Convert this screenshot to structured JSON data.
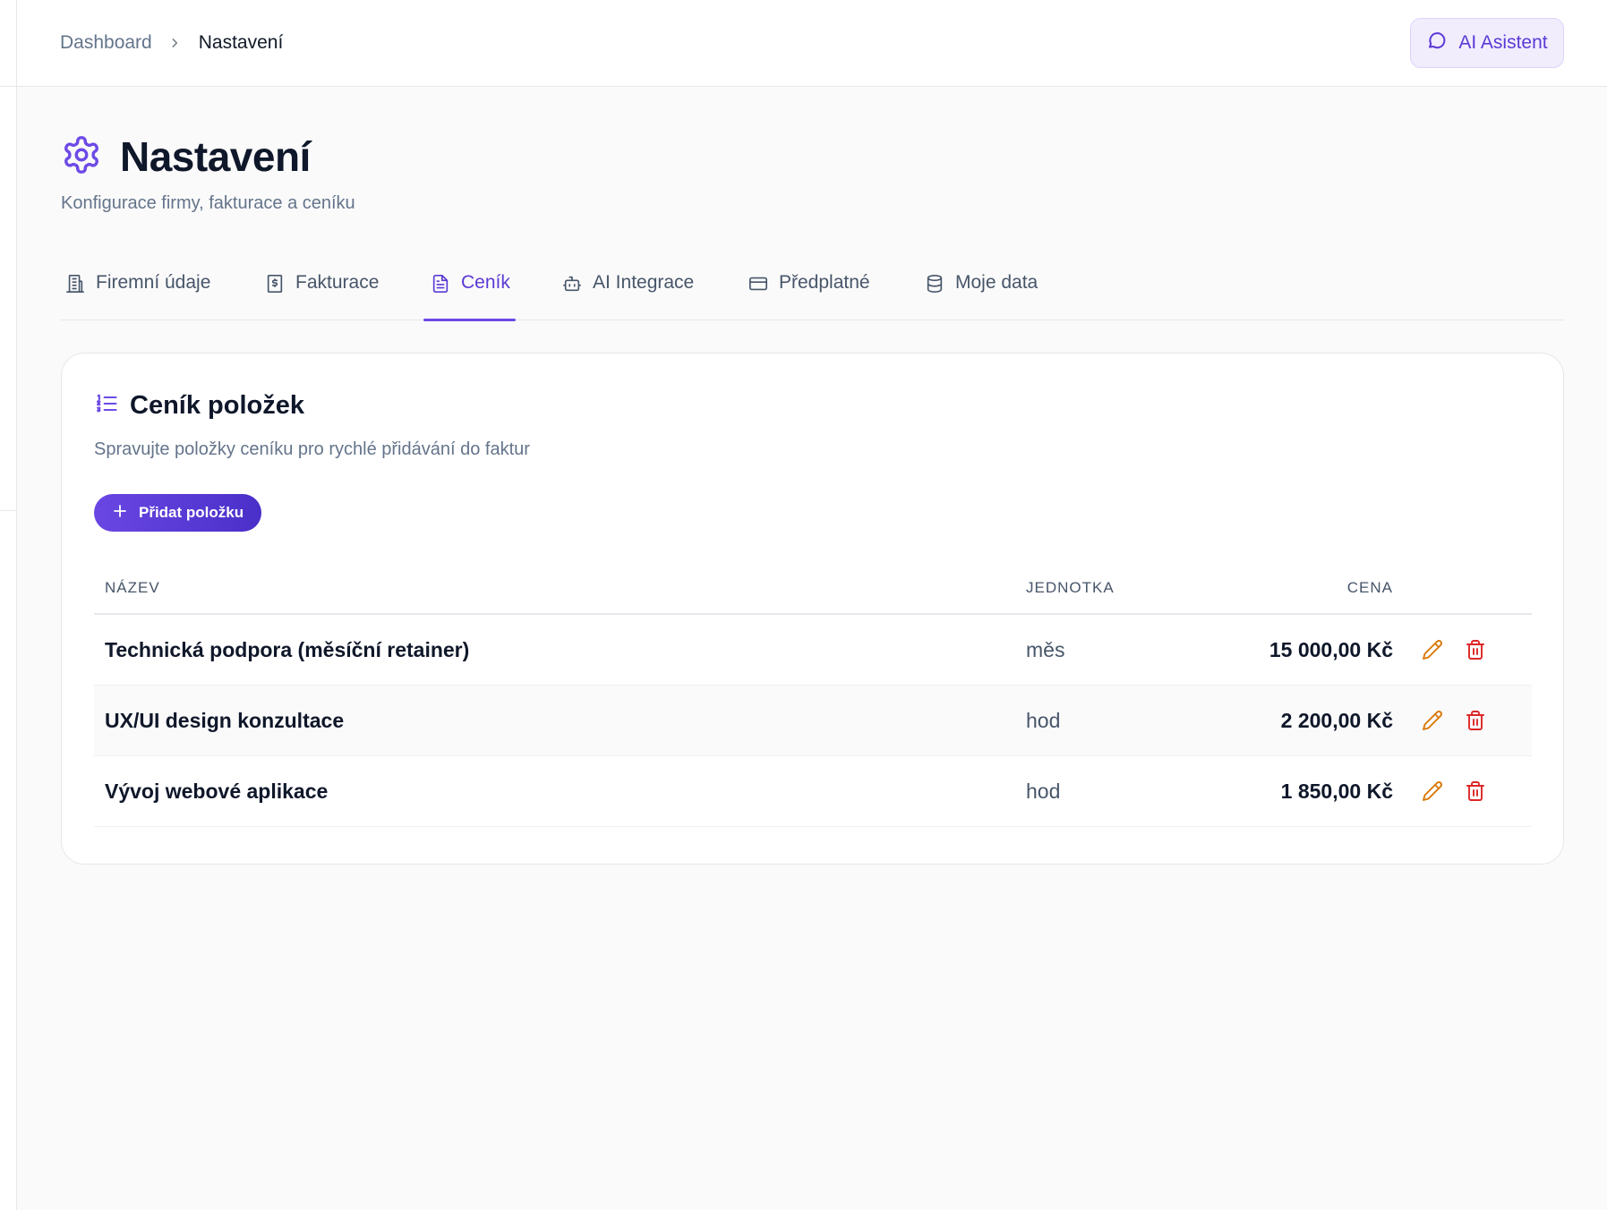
{
  "breadcrumb": {
    "parent": "Dashboard",
    "current": "Nastavení"
  },
  "ai_button": {
    "label": "AI Asistent"
  },
  "page": {
    "title": "Nastavení",
    "subtitle": "Konfigurace firmy, fakturace a ceníku"
  },
  "tabs": [
    {
      "label": "Firemní údaje",
      "icon": "building-icon",
      "active": false
    },
    {
      "label": "Fakturace",
      "icon": "receipt-dollar-icon",
      "active": false
    },
    {
      "label": "Ceník",
      "icon": "document-icon",
      "active": true
    },
    {
      "label": "AI Integrace",
      "icon": "bot-icon",
      "active": false
    },
    {
      "label": "Předplatné",
      "icon": "credit-card-icon",
      "active": false
    },
    {
      "label": "Moje data",
      "icon": "database-icon",
      "active": false
    }
  ],
  "card": {
    "title": "Ceník položek",
    "description": "Spravujte položky ceníku pro rychlé přidávání do faktur",
    "add_button": "Přidat položku"
  },
  "table": {
    "columns": [
      "NÁZEV",
      "JEDNOTKA",
      "CENA"
    ],
    "rows": [
      {
        "name": "Technická podpora (měsíční retainer)",
        "unit": "měs",
        "price": "15 000,00 Kč"
      },
      {
        "name": "UX/UI design konzultace",
        "unit": "hod",
        "price": "2 200,00 Kč"
      },
      {
        "name": "Vývoj webové aplikace",
        "unit": "hod",
        "price": "1 850,00 Kč"
      }
    ]
  },
  "colors": {
    "accent": "#6d4ae6",
    "edit_icon": "#d97706",
    "delete_icon": "#dc2626"
  }
}
